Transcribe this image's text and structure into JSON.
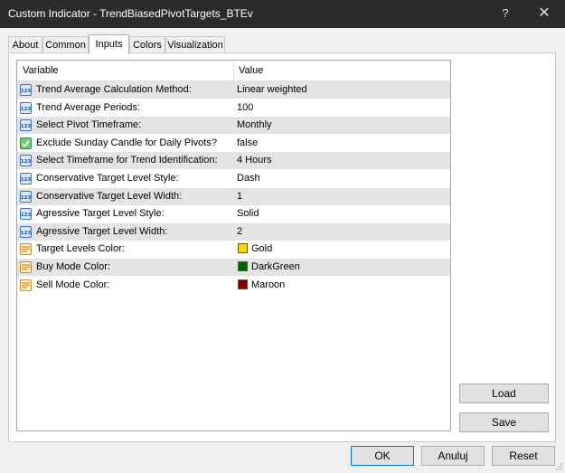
{
  "window": {
    "title": "Custom Indicator - TrendBiasedPivotTargets_BTEv",
    "help_glyph": "?",
    "close_glyph": "✕"
  },
  "tabs": [
    {
      "label": "About"
    },
    {
      "label": "Common"
    },
    {
      "label": "Inputs",
      "active": true
    },
    {
      "label": "Colors"
    },
    {
      "label": "Visualization"
    }
  ],
  "grid": {
    "columns": {
      "variable": "Variable",
      "value": "Value"
    },
    "rows": [
      {
        "name": "Trend Average Calculation Method:",
        "value": "Linear weighted",
        "icon": "numeric-input-icon"
      },
      {
        "name": "Trend Average Periods:",
        "value": "100",
        "icon": "numeric-input-icon"
      },
      {
        "name": "Select Pivot Timeframe:",
        "value": "Monthly",
        "icon": "numeric-input-icon"
      },
      {
        "name": "Exclude Sunday Candle for Daily Pivots?",
        "value": "false",
        "icon": "boolean-input-icon"
      },
      {
        "name": "Select Timeframe for Trend Identification:",
        "value": "4 Hours",
        "icon": "numeric-input-icon"
      },
      {
        "name": "Conservative Target Level Style:",
        "value": "Dash",
        "icon": "numeric-input-icon"
      },
      {
        "name": "Conservative Target Level Width:",
        "value": "1",
        "icon": "numeric-input-icon"
      },
      {
        "name": "Agressive Target Level Style:",
        "value": "Solid",
        "icon": "numeric-input-icon"
      },
      {
        "name": "Agressive Target Level Width:",
        "value": "2",
        "icon": "numeric-input-icon"
      },
      {
        "name": "Target Levels Color:",
        "value": "Gold",
        "icon": "color-input-icon",
        "swatch": "#ffd700"
      },
      {
        "name": "Buy Mode Color:",
        "value": "DarkGreen",
        "icon": "color-input-icon",
        "swatch": "#006400"
      },
      {
        "name": "Sell Mode Color:",
        "value": "Maroon",
        "icon": "color-input-icon",
        "swatch": "#800000"
      }
    ]
  },
  "side_buttons": {
    "load": "Load",
    "save": "Save"
  },
  "footer_buttons": {
    "ok": "OK",
    "cancel": "Anuluj",
    "reset": "Reset"
  },
  "colors": {
    "titlebar": "#2b2b2b",
    "default_button_border": "#0078d7",
    "zebra": "#e4e4e4"
  }
}
